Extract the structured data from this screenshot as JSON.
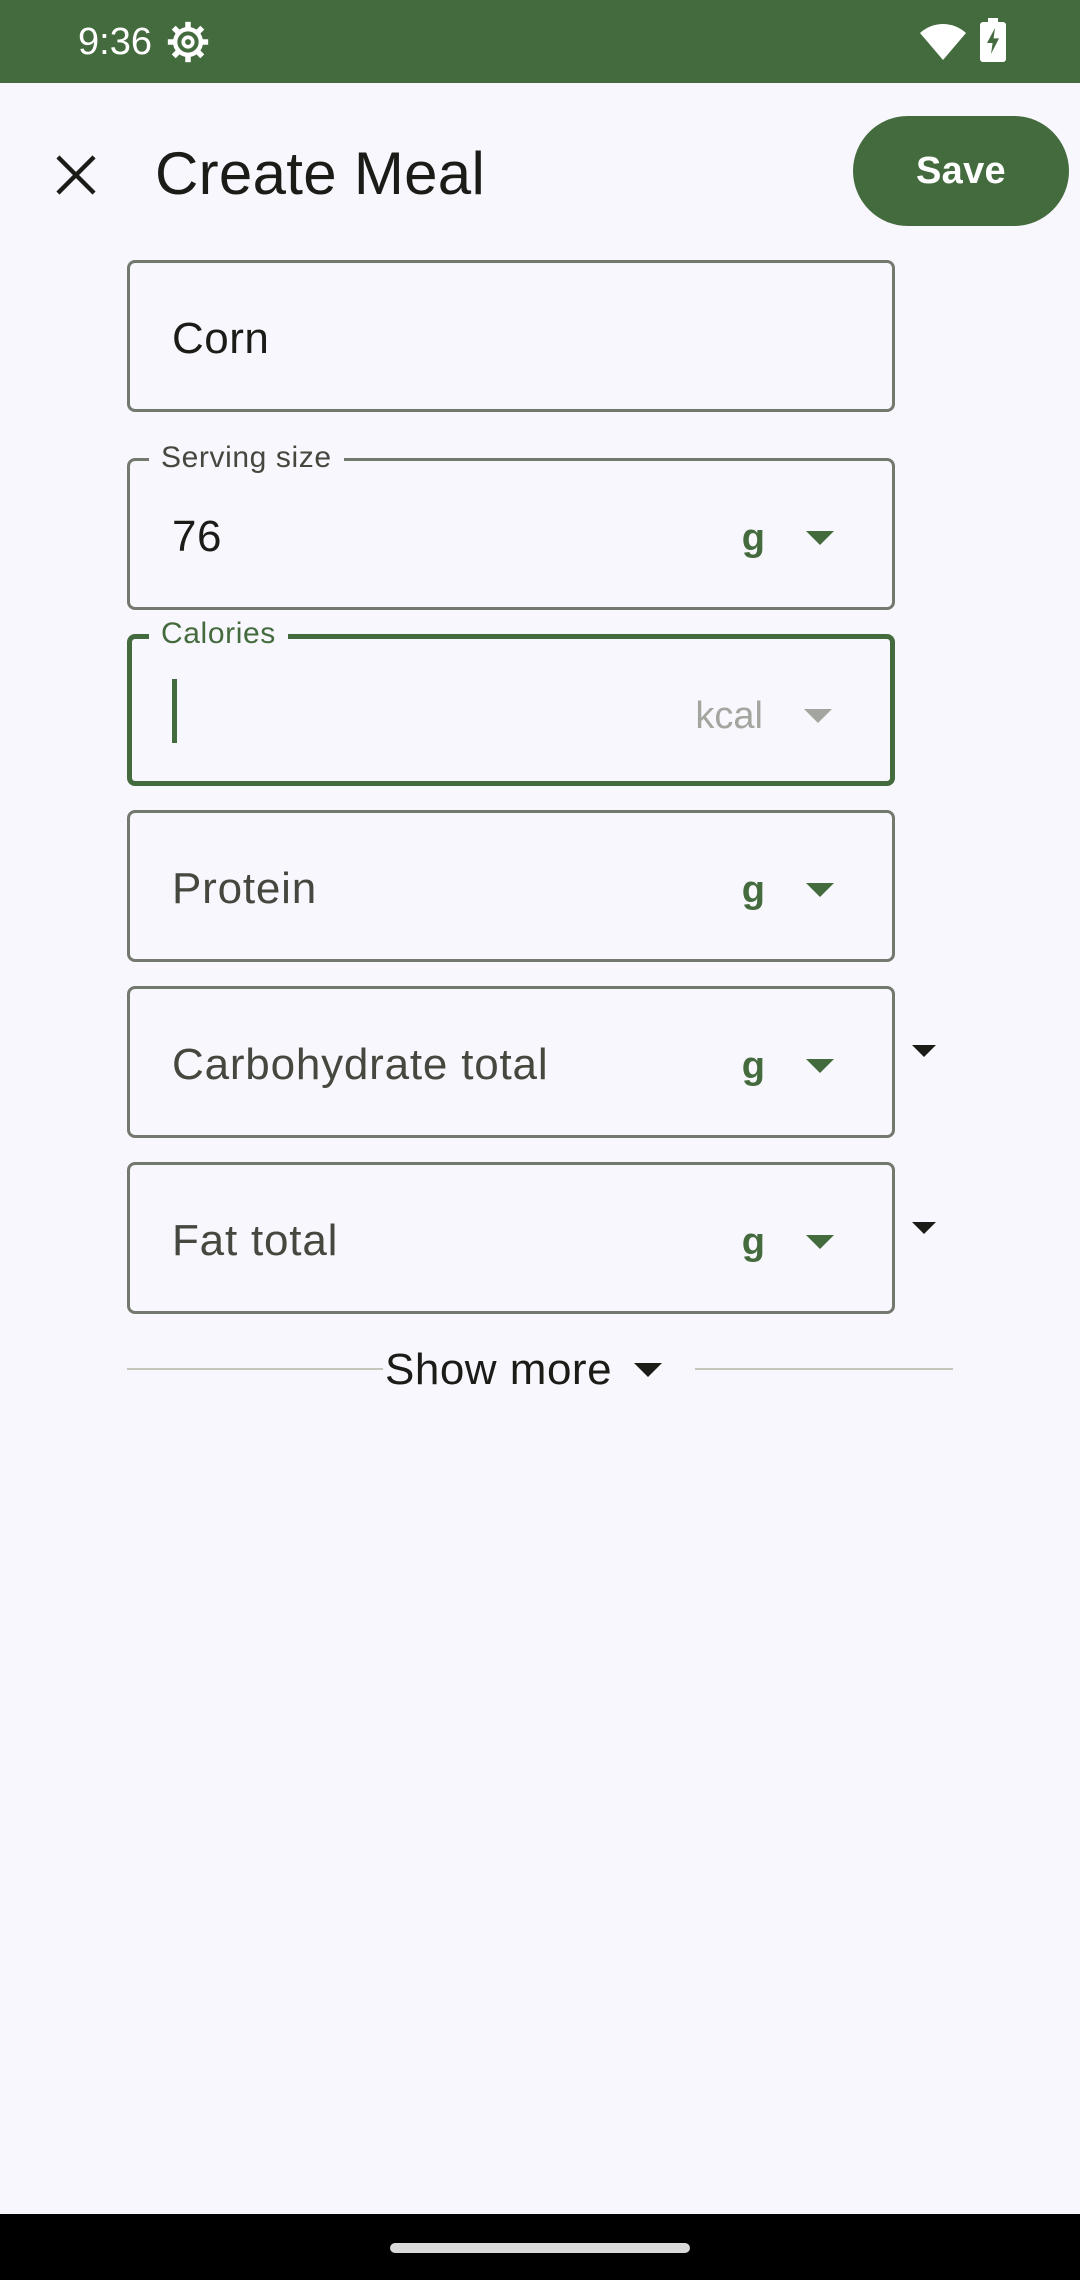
{
  "status_bar": {
    "time": "9:36",
    "icons": [
      "settings-gear-icon",
      "wifi-icon",
      "battery-charging-icon"
    ]
  },
  "app_bar": {
    "close_icon": "close-icon",
    "title": "Create Meal",
    "save_label": "Save"
  },
  "form": {
    "name": {
      "value": "Corn"
    },
    "serving_size": {
      "label": "Serving size",
      "value": "76",
      "unit": "g"
    },
    "calories": {
      "label": "Calories",
      "value": "",
      "unit": "kcal",
      "focused": true
    },
    "protein": {
      "placeholder": "Protein",
      "unit": "g"
    },
    "carbohydrate": {
      "placeholder": "Carbohydrate total",
      "unit": "g"
    },
    "fat": {
      "placeholder": "Fat total",
      "unit": "g"
    }
  },
  "show_more_label": "Show more",
  "colors": {
    "primary": "#446b3d",
    "background": "#f8f7fd",
    "outline": "#74796f",
    "on_surface": "#1b1c18"
  }
}
